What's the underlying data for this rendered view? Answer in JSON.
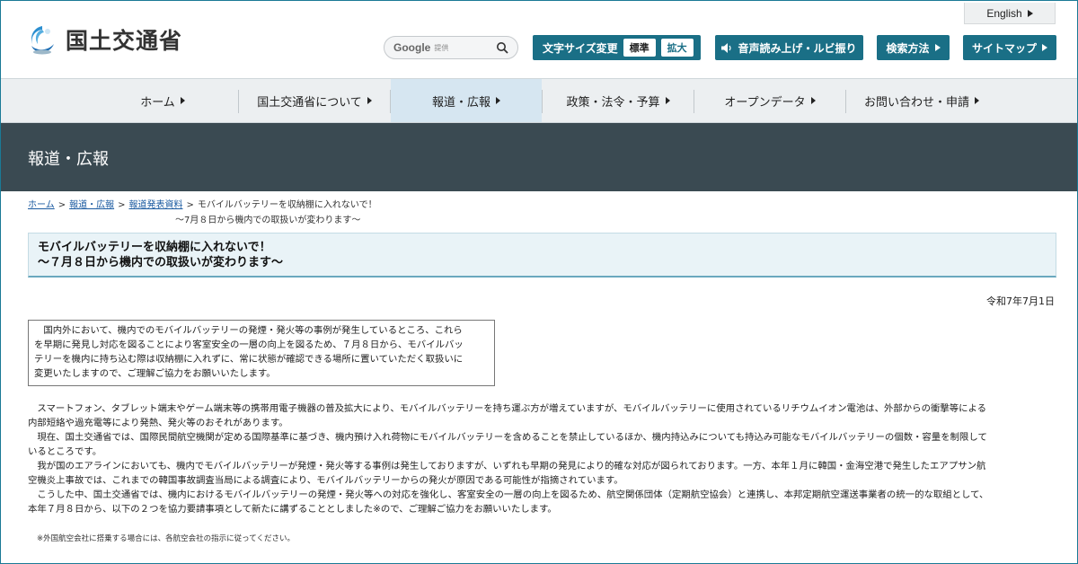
{
  "header": {
    "logo_text": "国土交通省",
    "language_link": "English",
    "search": {
      "brand": "Google",
      "sub": "提供"
    },
    "font_size": {
      "label": "文字サイズ変更",
      "standard": "標準",
      "large": "拡大"
    },
    "voice": "音声読み上げ・ルビ振り",
    "search_method": "検索方法",
    "sitemap": "サイトマップ"
  },
  "nav": {
    "items": [
      {
        "label": "ホーム"
      },
      {
        "label": "国土交通省について"
      },
      {
        "label": "報道・広報"
      },
      {
        "label": "政策・法令・予算"
      },
      {
        "label": "オープンデータ"
      },
      {
        "label": "お問い合わせ・申請"
      }
    ],
    "active_index": 2
  },
  "page_title": "報道・広報",
  "breadcrumb": {
    "home": "ホーム",
    "press": "報道・広報",
    "releases": "報道発表資料",
    "sep": ">",
    "current_line1": "モバイルバッテリーを収納棚に入れないで！",
    "current_line2": "～7月８日から機内での取扱いが変わります～"
  },
  "headline": {
    "line1": "モバイルバッテリーを収納棚に入れないで！",
    "line2": "～７月８日から機内での取扱いが変わります～"
  },
  "date": "令和7年7月1日",
  "summary": [
    "　国内外において、機内でのモバイルバッテリーの発煙・発火等の事例が発生しているところ、これら",
    "を早期に発見し対応を図ることにより客室安全の一層の向上を図るため、７月８日から、モバイルバッ",
    "テリーを機内に持ち込む際は収納棚に入れずに、常に状態が確認できる場所に置いていただく取扱いに",
    "変更いたしますので、ご理解ご協力をお願いいたします。"
  ],
  "body": [
    "　スマートフォン、タブレット端末やゲーム端末等の携帯用電子機器の普及拡大により、モバイルバッテリーを持ち運ぶ方が増えていますが、モバイルバッテリーに使用されているリチウムイオン電池は、外部からの衝撃等による",
    "内部短絡や過充電等により発熱、発火等のおそれがあります。",
    "　現在、国土交通省では、国際民間航空機関が定める国際基準に基づき、機内預け入れ荷物にモバイルバッテリーを含めることを禁止しているほか、機内持込みについても持込み可能なモバイルバッテリーの個数・容量を制限して",
    "いるところです。",
    "　我が国のエアラインにおいても、機内でモバイルバッテリーが発煙・発火等する事例は発生しておりますが、いずれも早期の発見により的確な対応が図られております。一方、本年１月に韓国・金海空港で発生したエアプサン航",
    "空機炎上事故では、これまでの韓国事故調査当局による調査により、モバイルバッテリーからの発火が原因である可能性が指摘されています。",
    "　こうした中、国土交通省では、機内におけるモバイルバッテリーの発煙・発火等への対応を強化し、客室安全の一層の向上を図るため、航空関係団体（定期航空協会）と連携し、本邦定期航空運送事業者の統一的な取組として、",
    "本年７月８日から、以下の２つを協力要請事項として新たに講ずることとしました※ので、ご理解ご協力をお願いいたします。"
  ],
  "note": "※外国航空会社に搭乗する場合には、各航空会社の指示に従ってください。",
  "colors": {
    "accent": "#1a6f86",
    "titlebar": "#3a4a52",
    "nav_bg": "#eceff1"
  }
}
